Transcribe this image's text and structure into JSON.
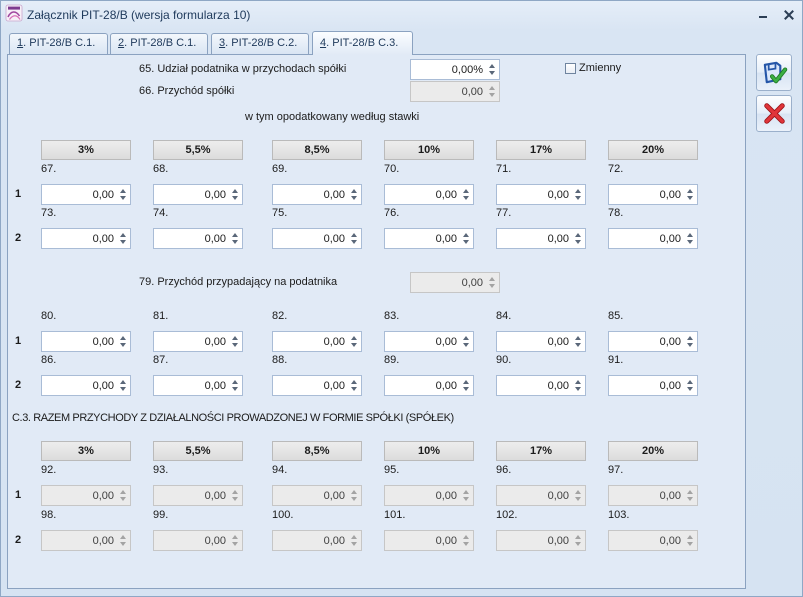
{
  "window": {
    "title": "Załącznik PIT-28/B (wersja formularza 10)",
    "app_icon": "pit-form-icon",
    "minimize_icon": "minimize-icon",
    "close_icon": "close-icon"
  },
  "tabs": [
    {
      "hotkey": "1",
      "text": ". PIT-28/B C.1.",
      "active": false
    },
    {
      "hotkey": "2",
      "text": ". PIT-28/B C.1.",
      "active": false
    },
    {
      "hotkey": "3",
      "text": ". PIT-28/B C.2.",
      "active": false
    },
    {
      "hotkey": "4",
      "text": ". PIT-28/B C.3.",
      "active": true
    }
  ],
  "share_field": {
    "label": "65. Udział podatnika w przychodach spółki",
    "value": "0,00%",
    "enabled": true
  },
  "variable_checkbox": {
    "label": "Zmienny",
    "checked": false
  },
  "company_income_field": {
    "label": "66. Przychód spółki",
    "value": "0,00",
    "enabled": false
  },
  "rates": [
    "3%",
    "5,5%",
    "8,5%",
    "10%",
    "17%",
    "20%"
  ],
  "section_company": {
    "heading": "w tym opodatkowany według stawki",
    "enabled": true,
    "rows": [
      {
        "label": "1",
        "cells": [
          {
            "num": "67.",
            "value": "0,00"
          },
          {
            "num": "68.",
            "value": "0,00"
          },
          {
            "num": "69.",
            "value": "0,00"
          },
          {
            "num": "70.",
            "value": "0,00"
          },
          {
            "num": "71.",
            "value": "0,00"
          },
          {
            "num": "72.",
            "value": "0,00"
          }
        ]
      },
      {
        "label": "2",
        "cells": [
          {
            "num": "73.",
            "value": "0,00"
          },
          {
            "num": "74.",
            "value": "0,00"
          },
          {
            "num": "75.",
            "value": "0,00"
          },
          {
            "num": "76.",
            "value": "0,00"
          },
          {
            "num": "77.",
            "value": "0,00"
          },
          {
            "num": "78.",
            "value": "0,00"
          }
        ]
      }
    ]
  },
  "taxpayer_income_field": {
    "label": "79. Przychód przypadający na podatnika",
    "value": "0,00",
    "enabled": false
  },
  "section_taxpayer": {
    "enabled": true,
    "rows": [
      {
        "label": "1",
        "cells": [
          {
            "num": "80.",
            "value": "0,00"
          },
          {
            "num": "81.",
            "value": "0,00"
          },
          {
            "num": "82.",
            "value": "0,00"
          },
          {
            "num": "83.",
            "value": "0,00"
          },
          {
            "num": "84.",
            "value": "0,00"
          },
          {
            "num": "85.",
            "value": "0,00"
          }
        ]
      },
      {
        "label": "2",
        "cells": [
          {
            "num": "86.",
            "value": "0,00"
          },
          {
            "num": "87.",
            "value": "0,00"
          },
          {
            "num": "88.",
            "value": "0,00"
          },
          {
            "num": "89.",
            "value": "0,00"
          },
          {
            "num": "90.",
            "value": "0,00"
          },
          {
            "num": "91.",
            "value": "0,00"
          }
        ]
      }
    ]
  },
  "section_total": {
    "heading": "C.3. RAZEM PRZYCHODY Z DZIAŁALNOŚCI PROWADZONEJ W FORMIE SPÓŁKI (SPÓŁEK)",
    "enabled": false,
    "rows": [
      {
        "label": "1",
        "cells": [
          {
            "num": "92.",
            "value": "0,00"
          },
          {
            "num": "93.",
            "value": "0,00"
          },
          {
            "num": "94.",
            "value": "0,00"
          },
          {
            "num": "95.",
            "value": "0,00"
          },
          {
            "num": "96.",
            "value": "0,00"
          },
          {
            "num": "97.",
            "value": "0,00"
          }
        ]
      },
      {
        "label": "2",
        "cells": [
          {
            "num": "98.",
            "value": "0,00"
          },
          {
            "num": "99.",
            "value": "0,00"
          },
          {
            "num": "100.",
            "value": "0,00"
          },
          {
            "num": "101.",
            "value": "0,00"
          },
          {
            "num": "102.",
            "value": "0,00"
          },
          {
            "num": "103.",
            "value": "0,00"
          }
        ]
      }
    ]
  },
  "actions": {
    "save_icon": "save-confirm-icon",
    "cancel_icon": "cancel-icon"
  },
  "colors": {
    "save_blue": "#2556a8",
    "confirm_green": "#2f9e34",
    "cancel_red": "#d8262b",
    "title_text": "#1e395b"
  }
}
